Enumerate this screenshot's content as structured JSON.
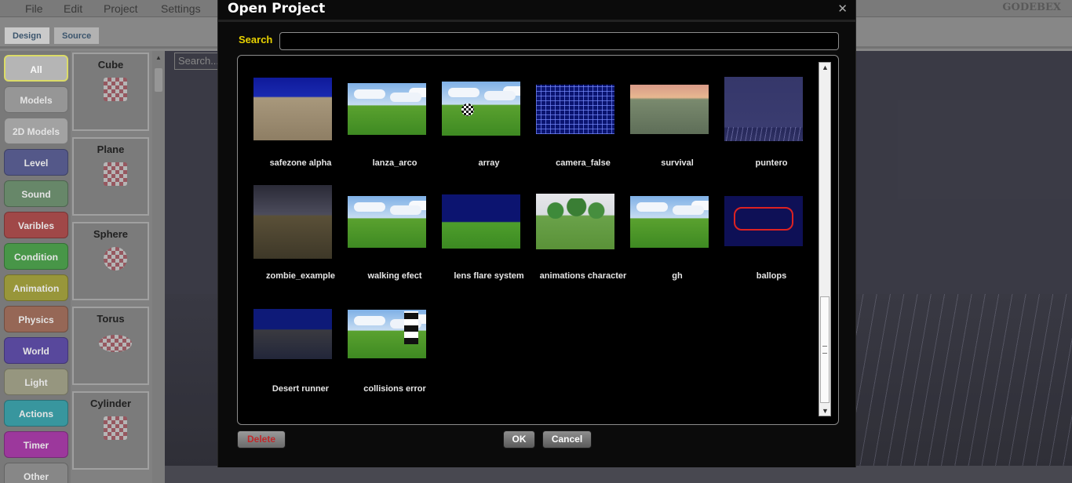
{
  "menu": {
    "items": [
      "File",
      "Edit",
      "Project",
      "Settings"
    ],
    "brand": "GODEBEX"
  },
  "editor_tabs": [
    "Design",
    "Source"
  ],
  "categories": [
    {
      "label": "All",
      "color": "#b9b9b9"
    },
    {
      "label": "Models",
      "color": "#9a9a9a"
    },
    {
      "label": "2D Models",
      "color": "#a6a6a6"
    },
    {
      "label": "Level",
      "color": "#565a8c"
    },
    {
      "label": "Sound",
      "color": "#6a8a6c"
    },
    {
      "label": "Varibles",
      "color": "#a44a4a"
    },
    {
      "label": "Condition",
      "color": "#4a9a4a"
    },
    {
      "label": "Animation",
      "color": "#9c9a3c"
    },
    {
      "label": "Physics",
      "color": "#9a6a58"
    },
    {
      "label": "World",
      "color": "#5a4aa0"
    },
    {
      "label": "Light",
      "color": "#9a9a82"
    },
    {
      "label": "Actions",
      "color": "#3a9aa2"
    },
    {
      "label": "Timer",
      "color": "#a03aa0"
    },
    {
      "label": "Other",
      "color": "#8a8a8a"
    }
  ],
  "objects": [
    "Cube",
    "Plane",
    "Sphere",
    "Torus",
    "Cylinder"
  ],
  "bg_search_placeholder": "Search...",
  "dialog": {
    "title": "Open Project",
    "close": "✕",
    "search_label": "Search",
    "search_value": "",
    "projects": [
      {
        "name": "safezone alpha",
        "thumb": "desert"
      },
      {
        "name": "lanza_arco",
        "thumb": "sky-grass"
      },
      {
        "name": "array",
        "thumb": "sky-grass-check"
      },
      {
        "name": "camera_false",
        "thumb": "grid-blue"
      },
      {
        "name": "survival",
        "thumb": "mountain"
      },
      {
        "name": "puntero",
        "thumb": "purple-floor"
      },
      {
        "name": "zombie_example",
        "thumb": "dark-wall"
      },
      {
        "name": "walking efect",
        "thumb": "sky-grass"
      },
      {
        "name": "lens flare system",
        "thumb": "navy-grass"
      },
      {
        "name": "animations character",
        "thumb": "trees"
      },
      {
        "name": "gh",
        "thumb": "sky-grass"
      },
      {
        "name": "ballops",
        "thumb": "hud"
      },
      {
        "name": "Desert runner",
        "thumb": "runner"
      },
      {
        "name": "collisions error",
        "thumb": "sky-grass-pole"
      }
    ],
    "buttons": {
      "delete": "Delete",
      "ok": "OK",
      "cancel": "Cancel"
    }
  }
}
